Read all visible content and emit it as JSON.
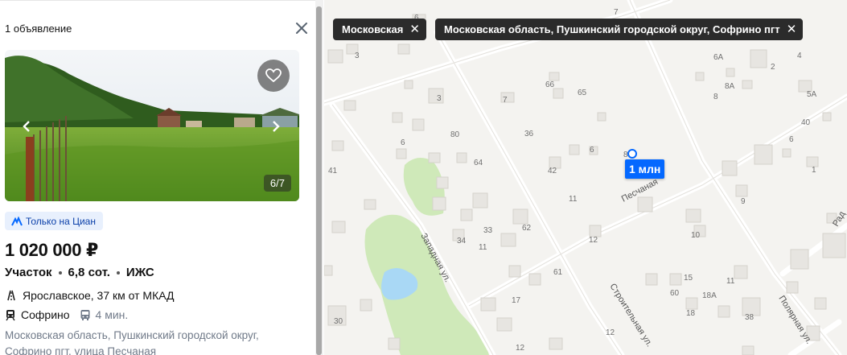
{
  "panel": {
    "count_label": "1 объявление",
    "photo_counter": "6/7",
    "badge": "Только на Циан",
    "price": "1 020 000 ₽",
    "params": [
      "Участок",
      "6,8 сот.",
      "ИЖС"
    ],
    "highway": "Ярославское, 37 км от МКАД",
    "station": "Софрино",
    "station_time": "4 мин.",
    "address": "Московская область, Пушкинский городской округ, Софрино пгт, улица Песчаная"
  },
  "map": {
    "filters": [
      "Московская",
      "Московская область, Пушкинский городской округ, Софрино пгт"
    ],
    "pin_label": "1 млн",
    "streets": [
      "Западная ул.",
      "Строительная ул.",
      "Полярная ул.",
      "Песчаная",
      "Рад"
    ],
    "house_numbers": [
      "7",
      "6А",
      "4",
      "3",
      "6",
      "66",
      "65",
      "8А",
      "8",
      "5А",
      "2",
      "3",
      "7",
      "40",
      "36",
      "80",
      "6",
      "6",
      "64",
      "6",
      "88",
      "1",
      "41",
      "42",
      "11",
      "9",
      "34",
      "33",
      "62",
      "10",
      "11",
      "12",
      "61",
      "15",
      "60",
      "18А",
      "11",
      "17",
      "18",
      "38",
      "30",
      "12"
    ]
  },
  "colors": {
    "accent": "#0468ff",
    "badge_bg": "#e8f0fd",
    "chip_bg": "#2b2b2b",
    "map_bg": "#f4f3f0",
    "park": "#cfe9b9",
    "water": "#a9d8f5"
  }
}
